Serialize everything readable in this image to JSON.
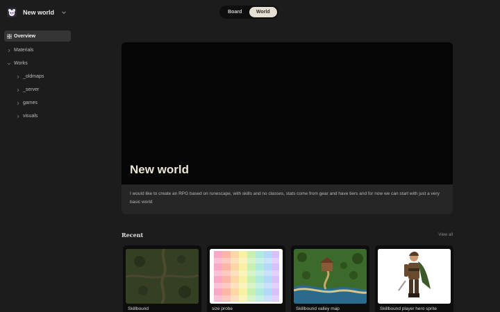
{
  "workspace": {
    "name": "New world",
    "logo": "panda-avatar-icon"
  },
  "view_toggle": {
    "options": [
      "Board",
      "World"
    ],
    "selected": "World"
  },
  "sidebar": {
    "overview": "Overview",
    "items": [
      {
        "label": "Materials"
      },
      {
        "label": "Works"
      },
      {
        "label": "_oldmaps"
      },
      {
        "label": "_server"
      },
      {
        "label": "games"
      },
      {
        "label": "visuals"
      }
    ]
  },
  "hero": {
    "title": "New world",
    "description": "I would like to create an RPG based on runescape, with skills and no classes, stats come from gear and have tiers and for now we can start with just a very basic world"
  },
  "recent": {
    "title": "Recent",
    "view_all": "View all",
    "cards": [
      {
        "label": "Skillbound"
      },
      {
        "label": "size probe"
      },
      {
        "label": "Skillbound valley map"
      },
      {
        "label": "Skillbound player hero sprite"
      }
    ]
  },
  "colors": {
    "accent": "#e6dfd1",
    "background": "#1c1c1c",
    "hero_canvas": "#050505"
  }
}
